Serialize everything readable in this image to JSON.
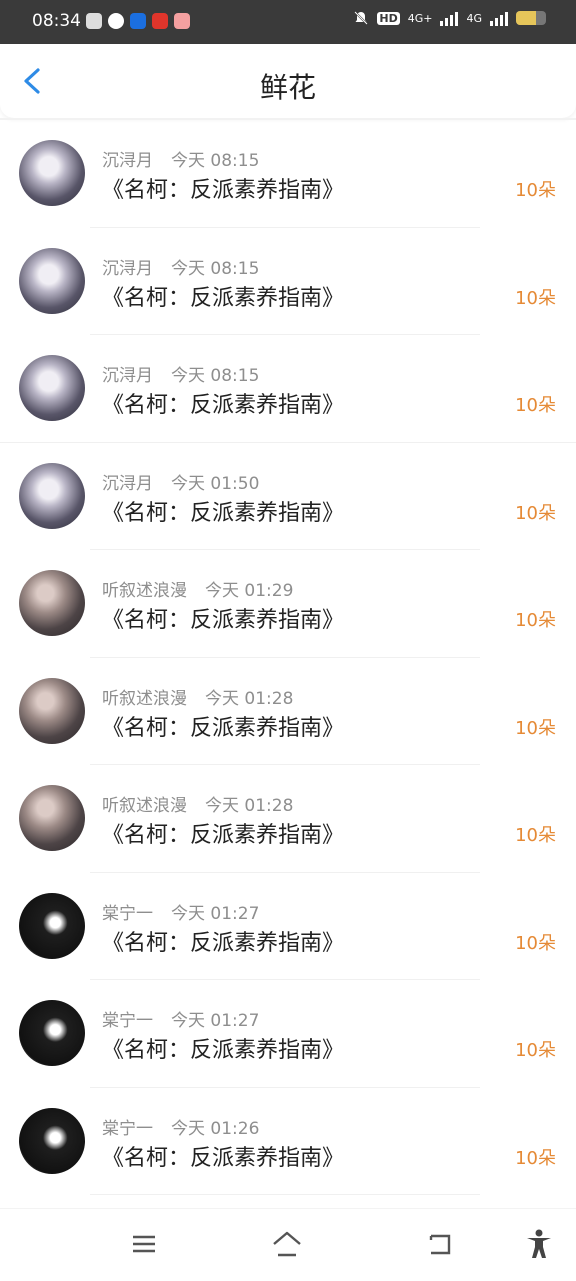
{
  "status_bar": {
    "time": "08:34",
    "network_1": "HD",
    "network_2": "4G+",
    "network_3": "4G",
    "battery_level": 0.65
  },
  "header": {
    "title": "鲜花",
    "back_icon": "chevron-left-icon"
  },
  "entries": [
    {
      "name": "沉浔月",
      "time": "今天 08:15",
      "book": "《名柯：反派素养指南》",
      "amount": "10朵",
      "avatar": "a"
    },
    {
      "name": "沉浔月",
      "time": "今天 08:15",
      "book": "《名柯：反派素养指南》",
      "amount": "10朵",
      "avatar": "a"
    },
    {
      "name": "沉浔月",
      "time": "今天 08:15",
      "book": "《名柯：反派素养指南》",
      "amount": "10朵",
      "avatar": "a"
    },
    {
      "name": "沉浔月",
      "time": "今天 01:50",
      "book": "《名柯：反派素养指南》",
      "amount": "10朵",
      "avatar": "a"
    },
    {
      "name": "听叙述浪漫",
      "time": "今天 01:29",
      "book": "《名柯：反派素养指南》",
      "amount": "10朵",
      "avatar": "b"
    },
    {
      "name": "听叙述浪漫",
      "time": "今天 01:28",
      "book": "《名柯：反派素养指南》",
      "amount": "10朵",
      "avatar": "b"
    },
    {
      "name": "听叙述浪漫",
      "time": "今天 01:28",
      "book": "《名柯：反派素养指南》",
      "amount": "10朵",
      "avatar": "b"
    },
    {
      "name": "棠宁一",
      "time": "今天 01:27",
      "book": "《名柯：反派素养指南》",
      "amount": "10朵",
      "avatar": "c"
    },
    {
      "name": "棠宁一",
      "time": "今天 01:27",
      "book": "《名柯：反派素养指南》",
      "amount": "10朵",
      "avatar": "c"
    },
    {
      "name": "棠宁一",
      "time": "今天 01:26",
      "book": "《名柯：反派素养指南》",
      "amount": "10朵",
      "avatar": "c"
    }
  ],
  "colors": {
    "accent": "#2e8be6",
    "amount": "#e58a36",
    "meta": "#8e8e8e",
    "status_bar": "#3a3a3a"
  },
  "nav": [
    "menu-icon",
    "home-icon",
    "back-icon",
    "accessibility-icon"
  ]
}
